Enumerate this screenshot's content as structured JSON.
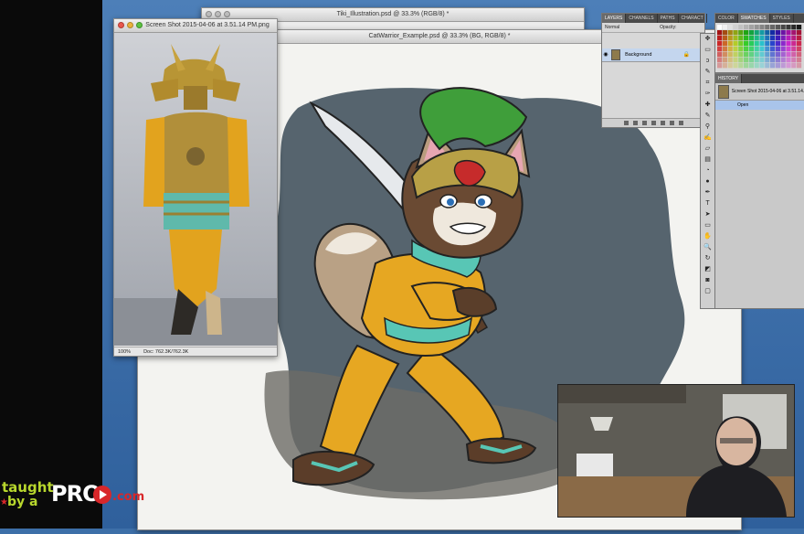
{
  "windows": {
    "tiki": {
      "title": "Tiki_Illustration.psd @ 33.3% (RGB/8) *"
    },
    "cat_warrior": {
      "title": "CatWarrior_Example.psd @ 33.3% (BG, RGB/8) *"
    },
    "reference": {
      "title": "Screen Shot 2015-04-06 at 3.51.14 PM.png",
      "zoom": "100%",
      "doc_info": "Doc: 762.3K/762.3K"
    }
  },
  "layers_panel": {
    "tabs": [
      "LAYERS",
      "CHANNELS",
      "PATHS",
      "CHARACT"
    ],
    "blend_mode": "Normal",
    "opacity_label": "Opacity:",
    "layer_name": "Background"
  },
  "swatches_panel": {
    "tabs": [
      "COLOR",
      "SWATCHES",
      "STYLES"
    ]
  },
  "history_panel": {
    "tab": "HISTORY",
    "snapshot_name": "Screen Shot 2015-04-06 at 3.51.14...",
    "step": "Open"
  },
  "toolbar": {
    "icons": [
      "move-icon",
      "marquee-icon",
      "lasso-icon",
      "quick-select-icon",
      "crop-icon",
      "eyedropper-icon",
      "healing-icon",
      "brush-icon",
      "stamp-icon",
      "history-brush-icon",
      "eraser-icon",
      "gradient-icon",
      "blur-icon",
      "dodge-icon",
      "pen-icon",
      "type-icon",
      "path-select-icon",
      "shape-icon",
      "hand-icon",
      "zoom-icon",
      "rotate-icon",
      "colors-icon",
      "mask-icon",
      "screen-mode-icon"
    ],
    "glyphs": [
      "✥",
      "▭",
      "ↄ",
      "✎",
      "⌗",
      "✑",
      "✚",
      "✎",
      "⚲",
      "✍",
      "▱",
      "▤",
      "◔",
      "●",
      "✒",
      "T",
      "➤",
      "▭",
      "✋",
      "🔍",
      "↻",
      "◩",
      "◙",
      "▢"
    ]
  },
  "logo": {
    "line1": "taught",
    "line2": "by a",
    "pro": "PRO",
    "domain": ".com"
  },
  "colors": {
    "desktop_blue": "#3d6fa8",
    "canvas_slate": "#56646e",
    "suit_yellow": "#e6a722",
    "accent_turquoise": "#58c6b5",
    "plume_green": "#3f9e3a",
    "logo_green": "#b8d72d",
    "logo_red": "#d8272a"
  }
}
